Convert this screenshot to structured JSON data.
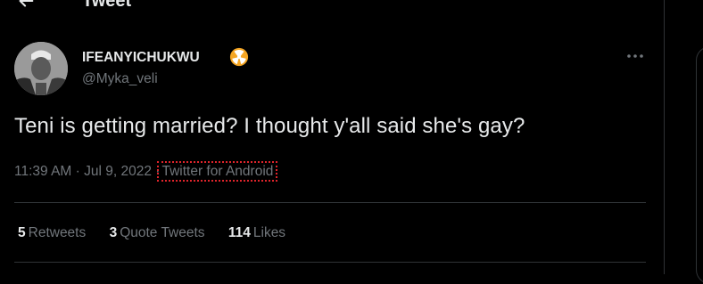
{
  "header": {
    "title": "Tweet"
  },
  "tweet": {
    "author_name": "IFEANYICHUKWU",
    "author_handle": "@Myka_veli",
    "text": "Teni is getting married? I thought y'all said she's gay?",
    "time": "11:39 AM",
    "separator": "·",
    "date": "Jul 9, 2022",
    "source": "Twitter for Android"
  },
  "stats": {
    "retweets_count": "5",
    "retweets_label": "Retweets",
    "quotes_count": "3",
    "quotes_label": "Quote Tweets",
    "likes_count": "114",
    "likes_label": "Likes"
  },
  "icons": {
    "back": "arrow-left-icon",
    "badge": "radioactive-icon",
    "more": "more-horizontal-icon"
  },
  "colors": {
    "background": "#000000",
    "text": "#e7e9ea",
    "muted": "#71767b",
    "badge": "#f5a623",
    "highlight": "#e0242b"
  }
}
